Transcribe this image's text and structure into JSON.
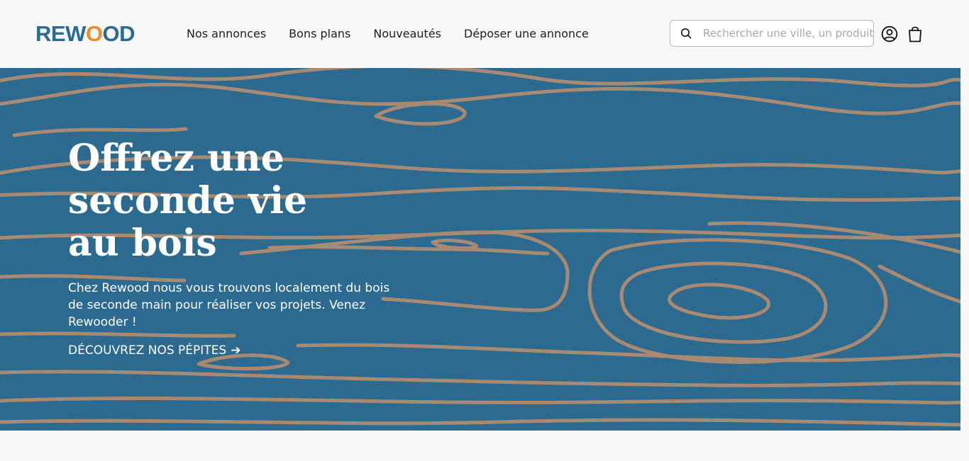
{
  "header": {
    "logo": {
      "part1": "REW",
      "part2": "O",
      "part3": "OD"
    },
    "nav": [
      {
        "label": "Nos annonces"
      },
      {
        "label": "Bons plans"
      },
      {
        "label": "Nouveautés"
      },
      {
        "label": "Déposer une annonce"
      }
    ],
    "search": {
      "placeholder": "Rechercher une ville, un produit",
      "value": ""
    },
    "icons": {
      "search": "search-icon",
      "account": "user-circle-icon",
      "cart": "shopping-bag-icon"
    }
  },
  "hero": {
    "title_lines": [
      "Offrez une",
      "seconde vie",
      "au bois"
    ],
    "text": "Chez Rewood nous vous trouvons localement du bois de seconde main pour réaliser vos projets. Venez Rewooder !",
    "cta": "DÉCOUVREZ NOS PÉPITES",
    "cta_arrow": "➔"
  },
  "colors": {
    "brand_blue": "#2b6a92",
    "brand_orange": "#f08a2c",
    "hero_background": "#2d6a8f",
    "wood_grain": "#a88a72",
    "page_background": "#f8f8f6"
  }
}
